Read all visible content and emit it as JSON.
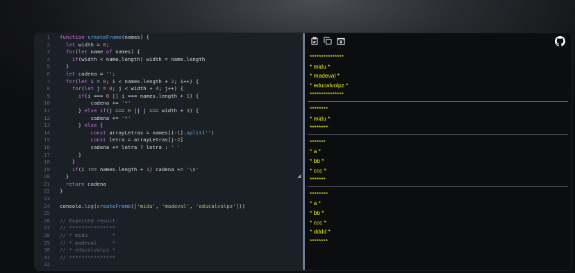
{
  "editor": {
    "lines": [
      {
        "n": "1",
        "html": "<span class='kw'>function</span> <span class='fn'>createFrame</span>(names) {"
      },
      {
        "n": "2",
        "html": "  <span class='kw'>let</span> width = <span class='num'>0</span>;"
      },
      {
        "n": "3",
        "html": "  <span class='kw'>for</span>(<span class='kw'>let</span> name <span class='kw'>of</span> names) {"
      },
      {
        "n": "4",
        "html": "    <span class='kw'>if</span>(width &lt; name.length) width = name.length"
      },
      {
        "n": "5",
        "html": "  }"
      },
      {
        "n": "6",
        "html": "  <span class='kw'>let</span> cadena = <span class='str'>''</span>;"
      },
      {
        "n": "7",
        "html": "  <span class='kw'>for</span>(<span class='kw'>let</span> i = <span class='num'>0</span>; i &lt; names.length + <span class='num'>2</span>; i++) {"
      },
      {
        "n": "8",
        "html": "    <span class='kw'>for</span>(<span class='kw'>let</span> j = <span class='num'>0</span>; j &lt; width + <span class='num'>4</span>; j++) {"
      },
      {
        "n": "9",
        "html": "      <span class='kw'>if</span>(i === <span class='num'>0</span> || i === names.length + <span class='num'>1</span>) {"
      },
      {
        "n": "10",
        "html": "          cadena += <span class='str'>'*'</span>"
      },
      {
        "n": "11",
        "html": "      } <span class='kw'>else if</span>(j === <span class='num'>0</span> || j === width + <span class='num'>3</span>) {"
      },
      {
        "n": "12",
        "html": "          cadena += <span class='str'>'*'</span>"
      },
      {
        "n": "13",
        "html": "      } <span class='kw'>else</span> {"
      },
      {
        "n": "14",
        "html": "          <span class='kw'>const</span> arrayLetras = names[i-<span class='num'>1</span>].<span class='fn'>split</span>(<span class='str'>''</span>)"
      },
      {
        "n": "15",
        "html": "          <span class='kw'>const</span> letra = arrayLetras[j-<span class='num'>2</span>]"
      },
      {
        "n": "16",
        "html": "          cadena += letra ? letra : <span class='str'>' '</span>"
      },
      {
        "n": "17",
        "html": "      }"
      },
      {
        "n": "18",
        "html": "    }"
      },
      {
        "n": "19",
        "html": "    <span class='kw'>if</span>(i !== names.length + <span class='num'>1</span>) cadena += <span class='str'>'\\n'</span>"
      },
      {
        "n": "20",
        "html": "  }"
      },
      {
        "n": "21",
        "html": "  <span class='kw'>return</span> cadena"
      },
      {
        "n": "22",
        "html": "}"
      },
      {
        "n": "23",
        "html": ""
      },
      {
        "n": "24",
        "html": "console.<span class='fn'>log</span>(<span class='fn'>createFrame</span>(<span class='br'>[</span><span class='str'>'midu'</span>, <span class='str'>'madeval'</span>, <span class='str'>'educalvolpz'</span><span class='br'>]</span>))"
      },
      {
        "n": "25",
        "html": ""
      },
      {
        "n": "26",
        "html": "<span class='cm'>// Expected result:</span>"
      },
      {
        "n": "27",
        "html": "<span class='cm'>// ***************</span>"
      },
      {
        "n": "28",
        "html": "<span class='cm'>// * midu        *</span>"
      },
      {
        "n": "29",
        "html": "<span class='cm'>// * madeval     *</span>"
      },
      {
        "n": "30",
        "html": "<span class='cm'>// * educalvolpz *</span>"
      },
      {
        "n": "31",
        "html": "<span class='cm'>// ***************</span>"
      },
      {
        "n": "32",
        "html": ""
      }
    ]
  },
  "toolbar": {
    "icons": [
      "clipboard-icon",
      "copy-icon",
      "download-icon"
    ],
    "github": "github-icon"
  },
  "output": {
    "blocks": [
      [
        "***************",
        "* midu *",
        "* madeval *",
        "* educalvolpz *",
        "***************"
      ],
      [
        "********",
        "* midu *",
        "********"
      ],
      [
        "*******",
        "* a *",
        "* bb *",
        "* ccc *",
        "*******"
      ],
      [
        "********",
        "* a *",
        "* bb *",
        "* ccc *",
        "* dddd *",
        "********"
      ]
    ]
  },
  "colors": {
    "output_text": "#e9f21a",
    "editor_bg": "#1b1f26",
    "preview_bg": "#0c0d0f",
    "divider": "#6b7d96"
  }
}
